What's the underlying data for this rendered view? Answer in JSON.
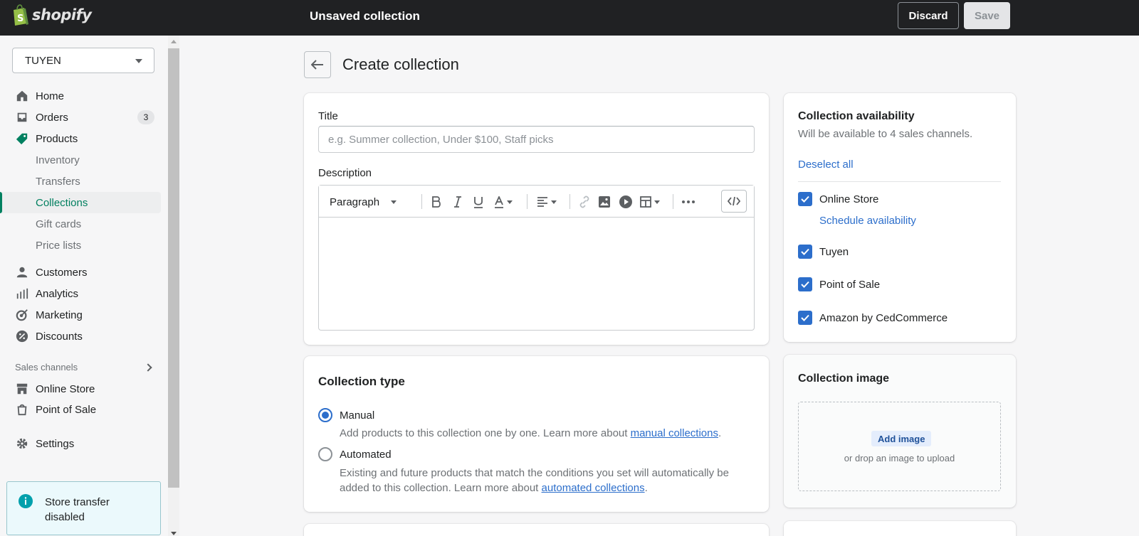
{
  "topbar": {
    "brand": "shopify",
    "status": "Unsaved collection",
    "discard_label": "Discard",
    "save_label": "Save"
  },
  "sidebar": {
    "store_name": "TUYEN",
    "nav": {
      "home": "Home",
      "orders": "Orders",
      "orders_badge": "3",
      "products": "Products",
      "inventory": "Inventory",
      "transfers": "Transfers",
      "collections": "Collections",
      "gift_cards": "Gift cards",
      "price_lists": "Price lists",
      "customers": "Customers",
      "analytics": "Analytics",
      "marketing": "Marketing",
      "discounts": "Discounts"
    },
    "sales_channels_heading": "Sales channels",
    "channels": {
      "online_store": "Online Store",
      "point_of_sale": "Point of Sale"
    },
    "settings": "Settings",
    "notice": "Store transfer disabled"
  },
  "main": {
    "page_title": "Create collection",
    "title_label": "Title",
    "title_placeholder": "e.g. Summer collection, Under $100, Staff picks",
    "title_value": "",
    "description_label": "Description",
    "editor": {
      "paragraph_label": "Paragraph"
    },
    "collection_type": {
      "heading": "Collection type",
      "manual_label": "Manual",
      "manual_help_prefix": "Add products to this collection one by one. Learn more about ",
      "manual_link": "manual collections",
      "manual_help_suffix": ".",
      "automated_label": "Automated",
      "automated_help_prefix": "Existing and future products that match the conditions you set will automatically be added to this collection. Learn more about ",
      "automated_link": "automated collections",
      "automated_help_suffix": ".",
      "selected": "Manual"
    }
  },
  "availability": {
    "heading": "Collection availability",
    "subtitle": "Will be available to 4 sales channels.",
    "deselect_all": "Deselect all",
    "channels": [
      {
        "label": "Online Store",
        "checked": true
      },
      {
        "label": "Tuyen",
        "checked": true
      },
      {
        "label": "Point of Sale",
        "checked": true
      },
      {
        "label": "Amazon by CedCommerce",
        "checked": true
      }
    ],
    "schedule_link": "Schedule availability"
  },
  "collection_image": {
    "heading": "Collection image",
    "add_image": "Add image",
    "drop_hint": "or drop an image to upload"
  },
  "colors": {
    "topbar": "#202123",
    "accent_green": "#008060",
    "link_blue": "#2c6ecb",
    "notice_bg": "#ebf9fc"
  }
}
